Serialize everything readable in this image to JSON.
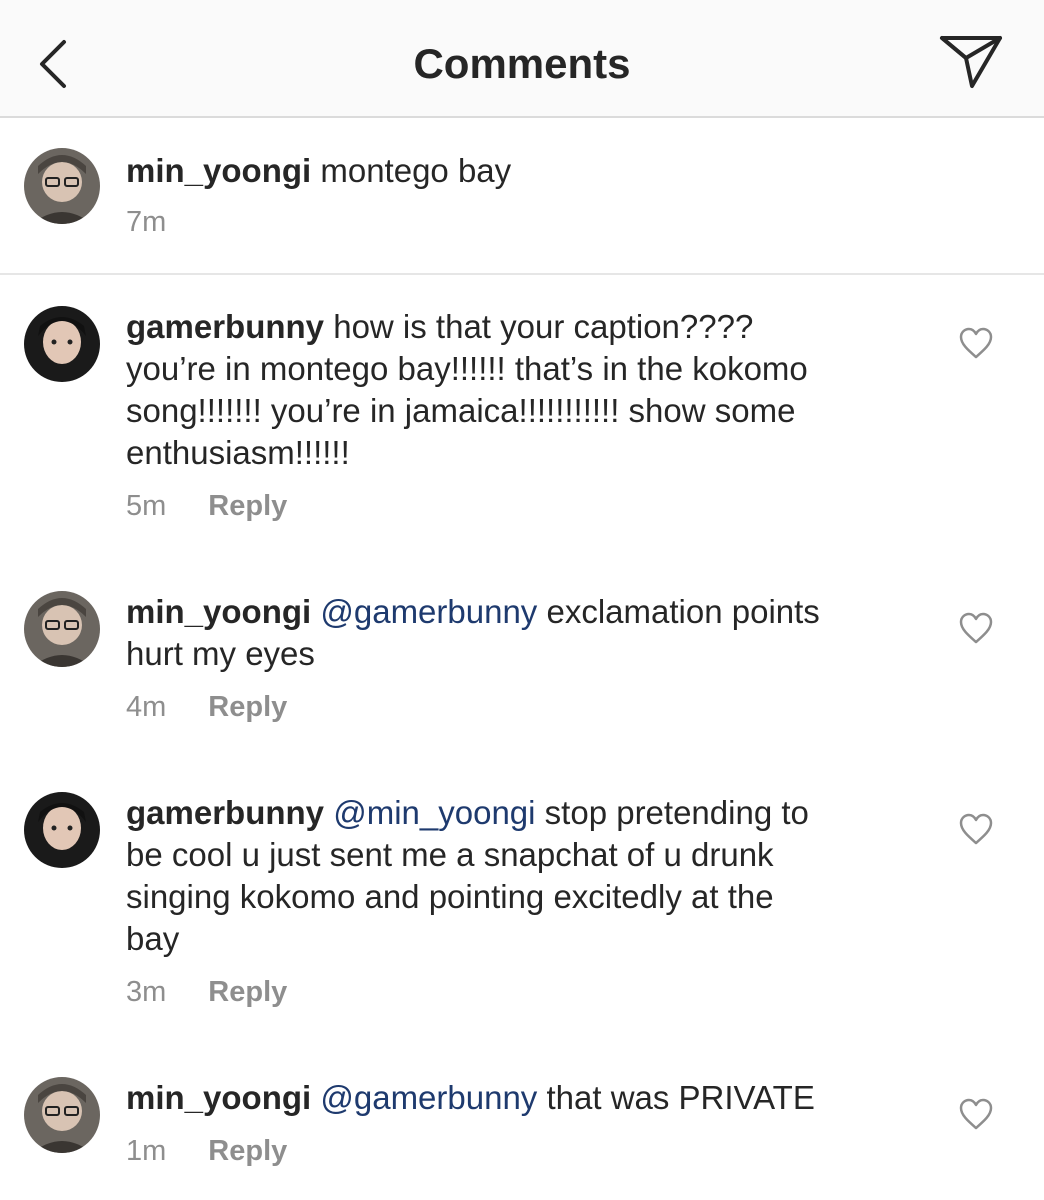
{
  "header": {
    "title": "Comments"
  },
  "caption": {
    "username": "min_yoongi",
    "text": "montego bay",
    "time": "7m"
  },
  "comments": [
    {
      "username": "gamerbunny",
      "mention": "",
      "text": "how is that your caption????",
      "lines": [
        "you’re in montego bay!!!!!! that’s in the kokomo",
        "song!!!!!!! you’re in jamaica!!!!!!!!!!! show some",
        "enthusiasm!!!!!!"
      ],
      "time": "5m",
      "reply": "Reply"
    },
    {
      "username": "min_yoongi",
      "mention": "@gamerbunny",
      "text": "exclamation points",
      "lines": [
        "hurt my eyes"
      ],
      "time": "4m",
      "reply": "Reply"
    },
    {
      "username": "gamerbunny",
      "mention": "@min_yoongi",
      "text": "stop pretending to",
      "lines": [
        "be cool u just sent me a snapchat of u drunk",
        "singing kokomo and pointing excitedly at the",
        "bay"
      ],
      "time": "3m",
      "reply": "Reply"
    },
    {
      "username": "min_yoongi",
      "mention": "@gamerbunny",
      "text": "that was PRIVATE",
      "lines": [],
      "time": "1m",
      "reply": "Reply"
    }
  ],
  "colors": {
    "mention": "#1e3a6e",
    "meta": "#8e8e8e",
    "divider": "#dbdbdb"
  }
}
